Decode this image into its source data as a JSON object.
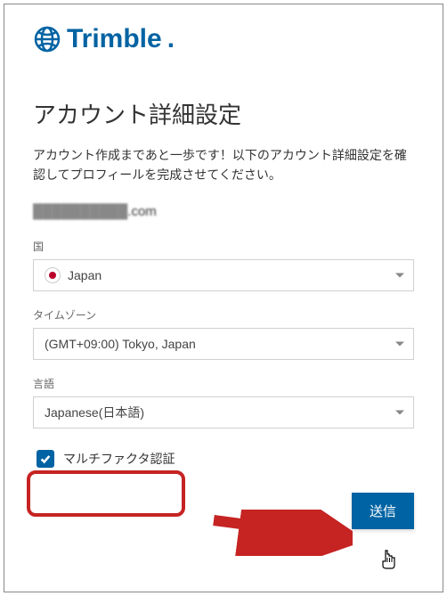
{
  "brand": {
    "name": "Trimble"
  },
  "page": {
    "title": "アカウント詳細設定",
    "description": "アカウント作成まであと一歩です！以下のアカウント詳細設定を確認してプロフィールを完成させてください。",
    "email_masked": "██████████",
    "email_suffix": ".com"
  },
  "fields": {
    "country": {
      "label": "国",
      "value": "Japan",
      "flag": "japan"
    },
    "timezone": {
      "label": "タイムゾーン",
      "value": "(GMT+09:00) Tokyo, Japan"
    },
    "language": {
      "label": "言語",
      "value": "Japanese(日本語)"
    }
  },
  "mfa": {
    "label": "マルチファクタ認証",
    "checked": true
  },
  "actions": {
    "submit": "送信"
  }
}
